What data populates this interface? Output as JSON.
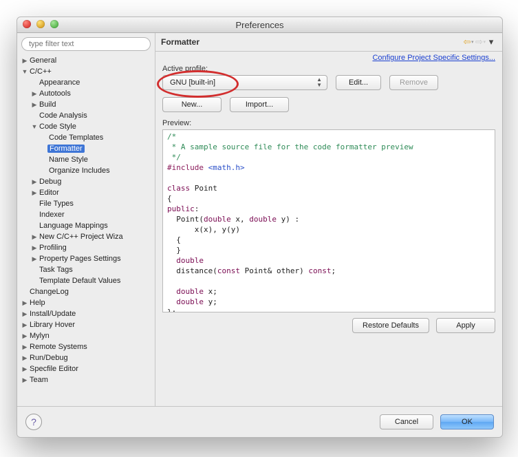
{
  "window": {
    "title": "Preferences"
  },
  "sidebar": {
    "search_placeholder": "type filter text",
    "items": {
      "general": "General",
      "ccpp": "C/C++",
      "appearance": "Appearance",
      "autotools": "Autotools",
      "build": "Build",
      "code_analysis": "Code Analysis",
      "code_style": "Code Style",
      "code_templates": "Code Templates",
      "formatter": "Formatter",
      "name_style": "Name Style",
      "organize_includes": "Organize Includes",
      "debug": "Debug",
      "editor": "Editor",
      "file_types": "File Types",
      "indexer": "Indexer",
      "language_mappings": "Language Mappings",
      "new_project_wiz": "New C/C++ Project Wiza",
      "profiling": "Profiling",
      "property_pages": "Property Pages Settings",
      "task_tags": "Task Tags",
      "template_defaults": "Template Default Values",
      "changelog": "ChangeLog",
      "help": "Help",
      "install_update": "Install/Update",
      "library_hover": "Library Hover",
      "mylyn": "Mylyn",
      "remote_systems": "Remote Systems",
      "run_debug": "Run/Debug",
      "specfile_editor": "Specfile Editor",
      "team": "Team"
    }
  },
  "header": {
    "title": "Formatter"
  },
  "link": {
    "configure_project": "Configure Project Specific Settings..."
  },
  "profile": {
    "label": "Active profile:",
    "selected": "GNU [built-in]",
    "edit": "Edit...",
    "remove": "Remove",
    "new": "New...",
    "import": "Import..."
  },
  "preview": {
    "label": "Preview:",
    "l1": "/*",
    "l2": " * A sample source file for the code formatter preview",
    "l3": " */",
    "l4a": "#include",
    "l4b": " <math.h>",
    "l6a": "class",
    "l6b": " Point",
    "l7": "{",
    "l8": "public",
    "l8b": ":",
    "l9a": "  Point(",
    "l9b": "double",
    "l9c": " x, ",
    "l9d": "double",
    "l9e": " y) :",
    "l10": "      x(x), y(y)",
    "l11": "  {",
    "l12": "  }",
    "l13a": "  double",
    "l14a": "  distance(",
    "l14b": "const",
    "l14c": " Point& other) ",
    "l14d": "const",
    "l14e": ";",
    "l16a": "  double",
    "l16b": " x;",
    "l17a": "  double",
    "l17b": " y;",
    "l18": "};"
  },
  "buttons": {
    "restore": "Restore Defaults",
    "apply": "Apply",
    "cancel": "Cancel",
    "ok": "OK"
  }
}
